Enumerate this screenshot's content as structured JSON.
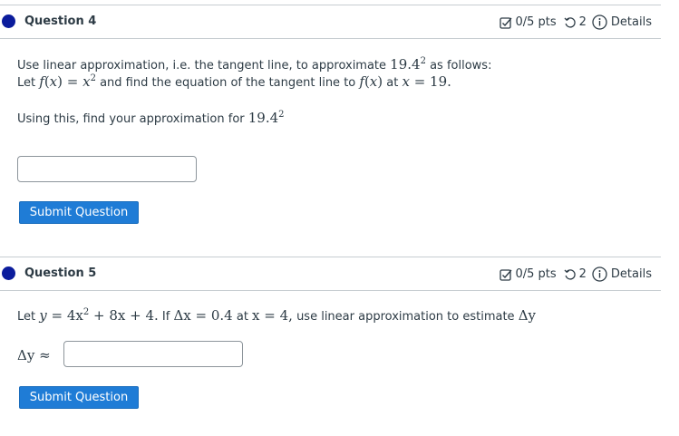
{
  "questions": [
    {
      "title": "Question 4",
      "score": "0/5 pts",
      "attempts": "2",
      "details_label": "Details",
      "line1_prefix": "Use linear approximation, i.e. the tangent line, to approximate ",
      "line1_value": "19.4",
      "line1_exp": "2",
      "line1_suffix": " as follows:",
      "line2_a": "Let ",
      "line2_func": "f",
      "line2_var": "x",
      "line2_rhs": "x",
      "line2_rhs_exp": "2",
      "line2_b": " and find the equation of the tangent line to ",
      "line2_at": " at ",
      "line2_point": "19.",
      "line3_prefix": "Using this, find your approximation for ",
      "line3_value": "19.4",
      "line3_exp": "2",
      "submit_label": "Submit Question"
    },
    {
      "title": "Question 5",
      "score": "0/5 pts",
      "attempts": "2",
      "details_label": "Details",
      "line1_a": "Let ",
      "line1_eq": "= 4x",
      "line1_exp": "2",
      "line1_tail": " + 8x + 4.",
      "line1_if": " If ",
      "line1_dx": "Δx = 0.4",
      "line1_at": " at ",
      "line1_x4": "x = 4,",
      "line1_end": " use linear approximation to estimate ",
      "line1_dy": "Δy",
      "answer_label": "Δy ≈",
      "submit_label": "Submit Question"
    }
  ],
  "colors": {
    "accent": "#1f7cd6",
    "dot": "#0b1c9c",
    "text": "#2d3b45"
  }
}
